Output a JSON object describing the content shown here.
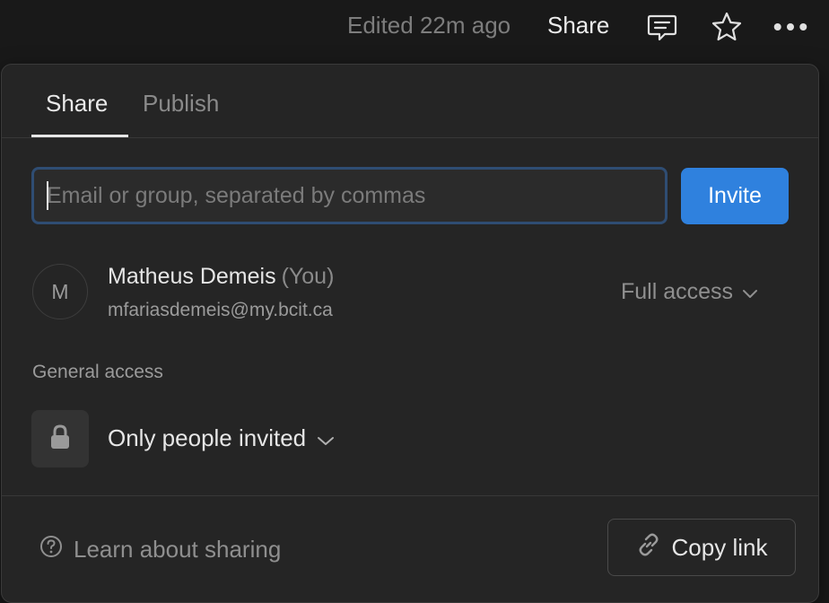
{
  "topbar": {
    "edited": "Edited 22m ago",
    "share": "Share",
    "icons": [
      "comment-icon",
      "star-icon",
      "more-icon"
    ]
  },
  "tabs": [
    {
      "label": "Share",
      "active": true
    },
    {
      "label": "Publish",
      "active": false
    }
  ],
  "invite": {
    "placeholder": "Email or group, separated by commas",
    "value": "",
    "button": "Invite"
  },
  "members": [
    {
      "initial": "M",
      "name": "Matheus Demeis",
      "you": "(You)",
      "email": "mfariasdemeis@my.bcit.ca",
      "access": "Full access"
    }
  ],
  "general_access": {
    "label": "General access",
    "value": "Only people invited"
  },
  "footer": {
    "learn": "Learn about sharing",
    "copy_link": "Copy link"
  },
  "colors": {
    "background": "#191919",
    "panel": "#252525",
    "accent": "#2f81de",
    "input_focus": "#2f4d73"
  }
}
